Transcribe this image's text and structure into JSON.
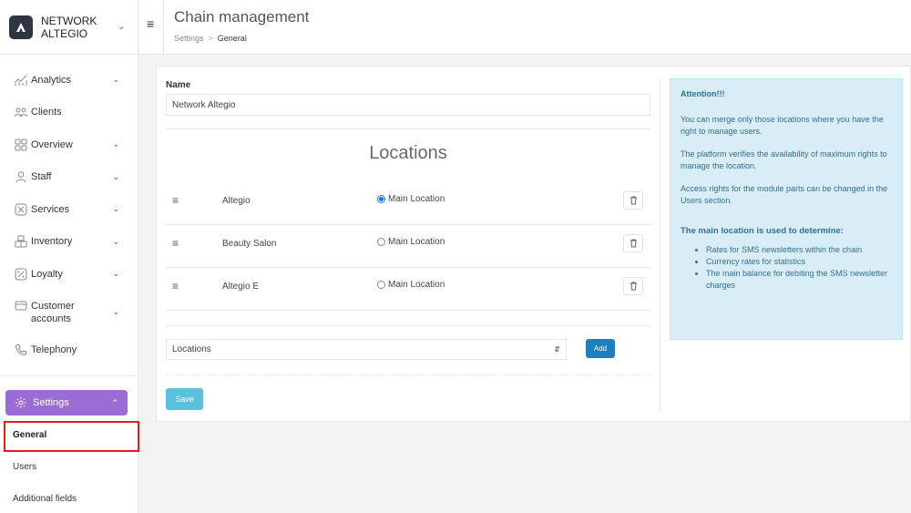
{
  "brand": {
    "name": "NETWORK ALTEGIO"
  },
  "sidebar": {
    "items": [
      {
        "label": "Analytics",
        "icon": "analytics-icon",
        "chevron": true
      },
      {
        "label": "Clients",
        "icon": "clients-icon",
        "chevron": false
      },
      {
        "label": "Overview",
        "icon": "overview-icon",
        "chevron": true
      },
      {
        "label": "Staff",
        "icon": "staff-icon",
        "chevron": true
      },
      {
        "label": "Services",
        "icon": "services-icon",
        "chevron": true
      },
      {
        "label": "Inventory",
        "icon": "inventory-icon",
        "chevron": true
      },
      {
        "label": "Loyalty",
        "icon": "loyalty-icon",
        "chevron": true
      },
      {
        "label": "Customer accounts",
        "icon": "wallet-icon",
        "chevron": true
      },
      {
        "label": "Telephony",
        "icon": "phone-icon",
        "chevron": false
      }
    ],
    "settings_label": "Settings",
    "settings_subitems": [
      "General",
      "Users",
      "Additional fields"
    ]
  },
  "header": {
    "title": "Chain management",
    "breadcrumb": [
      "Settings",
      "General"
    ]
  },
  "form": {
    "name_label": "Name",
    "name_value": "Network Altegio",
    "locations_heading": "Locations",
    "locations": [
      {
        "name": "Altegio",
        "radio_label": "Main Location",
        "selected": true
      },
      {
        "name": "Beauty Salon",
        "radio_label": "Main Location",
        "selected": false
      },
      {
        "name": "Altegio E",
        "radio_label": "Main Location",
        "selected": false
      }
    ],
    "select_value": "Locations",
    "add_label": "Add",
    "save_label": "Save"
  },
  "attention": {
    "title": "Attention!!!",
    "paragraphs": [
      "You can merge only those locations where you have the right to manage users.",
      "The platform verifies the availability of maximum rights to manage the location.",
      "Access rights for the module parts can be changed in the Users section."
    ],
    "subtitle": "The main location is used to determine:",
    "bullets": [
      "Rates for SMS newsletters within the chain",
      "Currency rates for statistics",
      "The main balance for debiting the SMS newsletter charges"
    ]
  },
  "colors": {
    "accent_purple": "#9b6cd3",
    "primary_blue": "#1c7fc4",
    "save_cyan": "#5bc0de",
    "info_bg": "#d9edf7",
    "highlight_red": "#e31b23"
  }
}
